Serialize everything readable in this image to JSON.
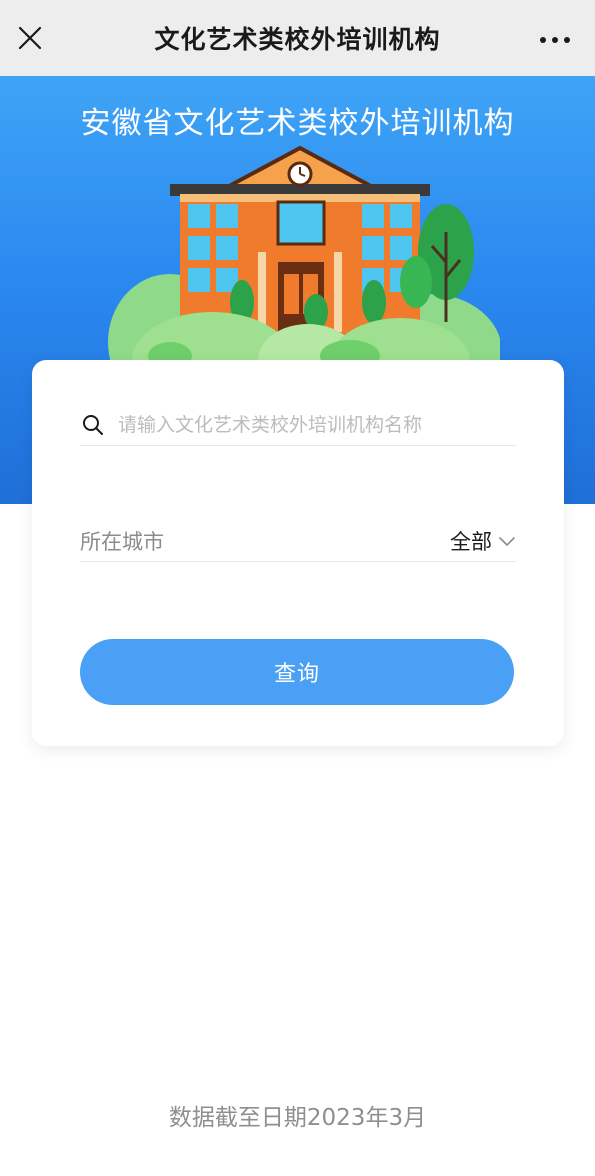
{
  "navbar": {
    "title": "文化艺术类校外培训机构",
    "close_icon": "close-icon",
    "more_icon": "more-dots-icon"
  },
  "hero": {
    "title": "安徽省文化艺术类校外培训机构",
    "illustration": "school-building-illustration",
    "background_color": "#2b8af0"
  },
  "search": {
    "placeholder": "请输入文化艺术类校外培训机构名称",
    "value": "",
    "icon": "search-icon"
  },
  "city_filter": {
    "label": "所在城市",
    "selected": "全部",
    "icon": "chevron-down-icon"
  },
  "query_button": {
    "label": "查询",
    "color": "#4aa0f5"
  },
  "footer": {
    "note": "数据截至日期2023年3月"
  }
}
